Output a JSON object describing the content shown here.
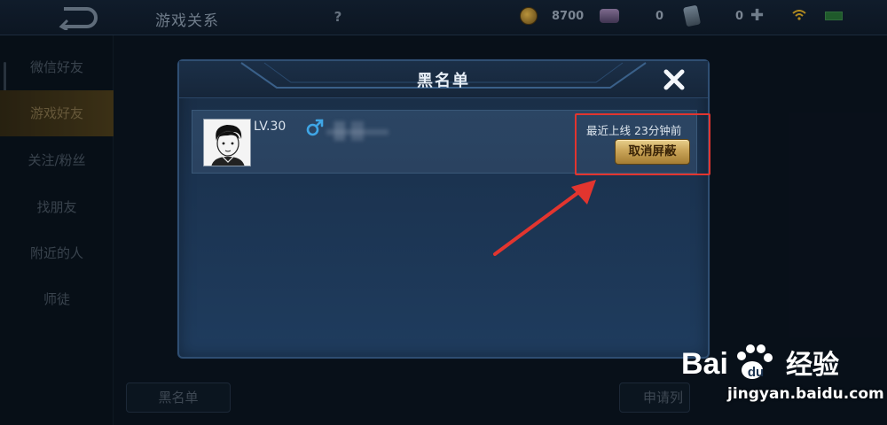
{
  "topbar": {
    "title": "游戏关系",
    "help_label": "?",
    "coins": "8700",
    "gems": "0",
    "vouchers": "0",
    "plus": "✚"
  },
  "sidebar": {
    "items": [
      {
        "label": "微信好友"
      },
      {
        "label": "游戏好友"
      },
      {
        "label": "关注/粉丝"
      },
      {
        "label": "找朋友"
      },
      {
        "label": "附近的人"
      },
      {
        "label": "师徒"
      }
    ]
  },
  "bottom": {
    "blacklist_label": "黑名单",
    "apply_label": "申请列"
  },
  "modal": {
    "title": "黑名单",
    "close_label": "✕",
    "entries": [
      {
        "level": "LV.30",
        "gender": "male",
        "last_online": "最近上线  23分钟前",
        "unblock_label": "取消屏蔽"
      }
    ]
  },
  "watermark": {
    "logo_text": "Bai du 经验",
    "url": "jingyan.baidu.com"
  },
  "colors": {
    "annotation": "#e2352f",
    "unblock_button": "#c9a458",
    "gender_male": "#3fa6e6"
  }
}
